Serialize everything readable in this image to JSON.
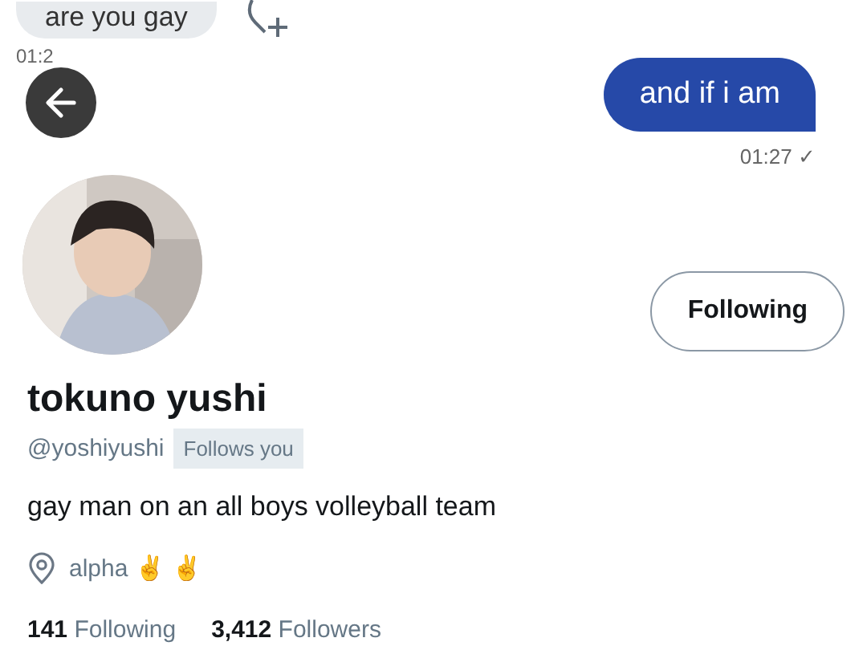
{
  "chat": {
    "received": {
      "text": "are you gay",
      "time": "01:2"
    },
    "sent": {
      "text": "and if i am",
      "time": "01:27",
      "read_mark": "✓"
    }
  },
  "profile": {
    "name": "tokuno yushi",
    "handle": "@yoshiyushi",
    "follows_you": "Follows you",
    "follow_button": "Following",
    "bio": "gay man on an all boys volleyball team",
    "location": "alpha ✌ ✌",
    "following_count": "141",
    "following_label": "Following",
    "followers_count": "3,412",
    "followers_label": "Followers"
  }
}
